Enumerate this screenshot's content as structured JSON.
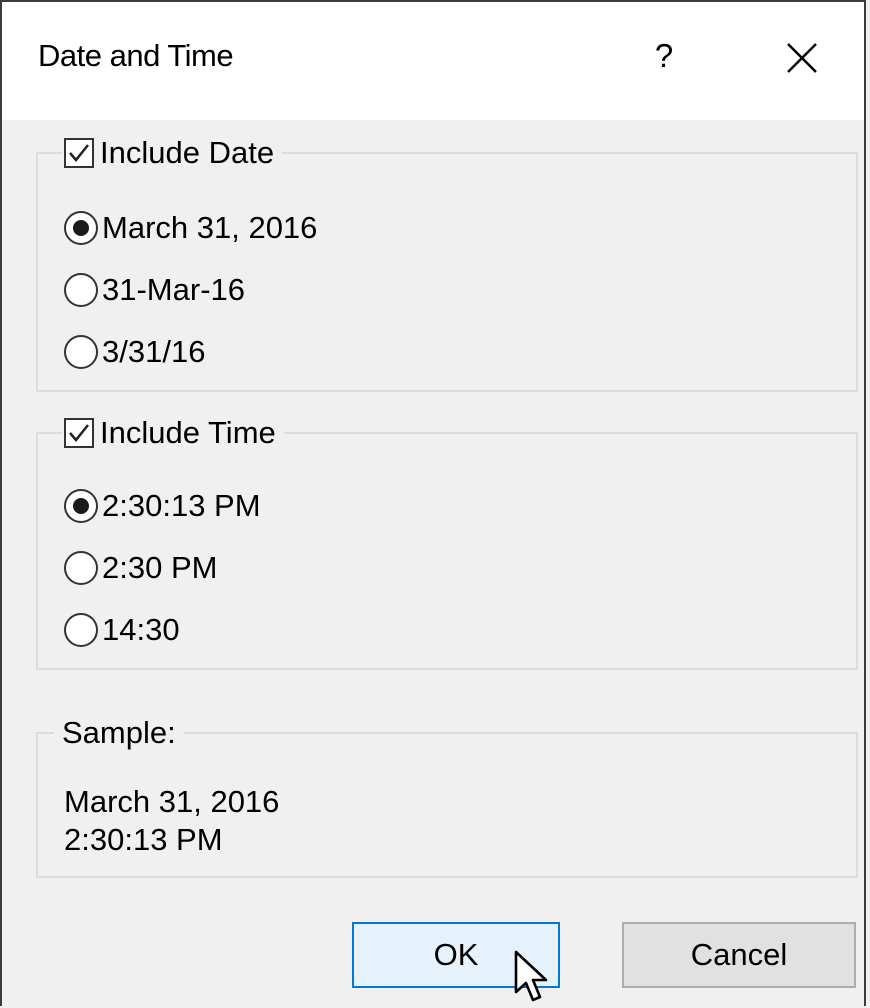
{
  "dialog": {
    "title": "Date and Time",
    "help_label": "?"
  },
  "date_group": {
    "checkbox_label": "Include Date",
    "checked": true,
    "options": [
      {
        "label": "March 31, 2016",
        "selected": true
      },
      {
        "label": "31-Mar-16",
        "selected": false
      },
      {
        "label": "3/31/16",
        "selected": false
      }
    ]
  },
  "time_group": {
    "checkbox_label": "Include Time",
    "checked": true,
    "options": [
      {
        "label": "2:30:13 PM",
        "selected": true
      },
      {
        "label": "2:30 PM",
        "selected": false
      },
      {
        "label": "14:30",
        "selected": false
      }
    ]
  },
  "sample": {
    "label": "Sample:",
    "line1": "March 31, 2016",
    "line2": "2:30:13 PM"
  },
  "buttons": {
    "ok": "OK",
    "cancel": "Cancel"
  },
  "colors": {
    "accent": "#0078d7",
    "ok_bg": "#e5f1fb",
    "dialog_bg": "#f0f0f0"
  }
}
